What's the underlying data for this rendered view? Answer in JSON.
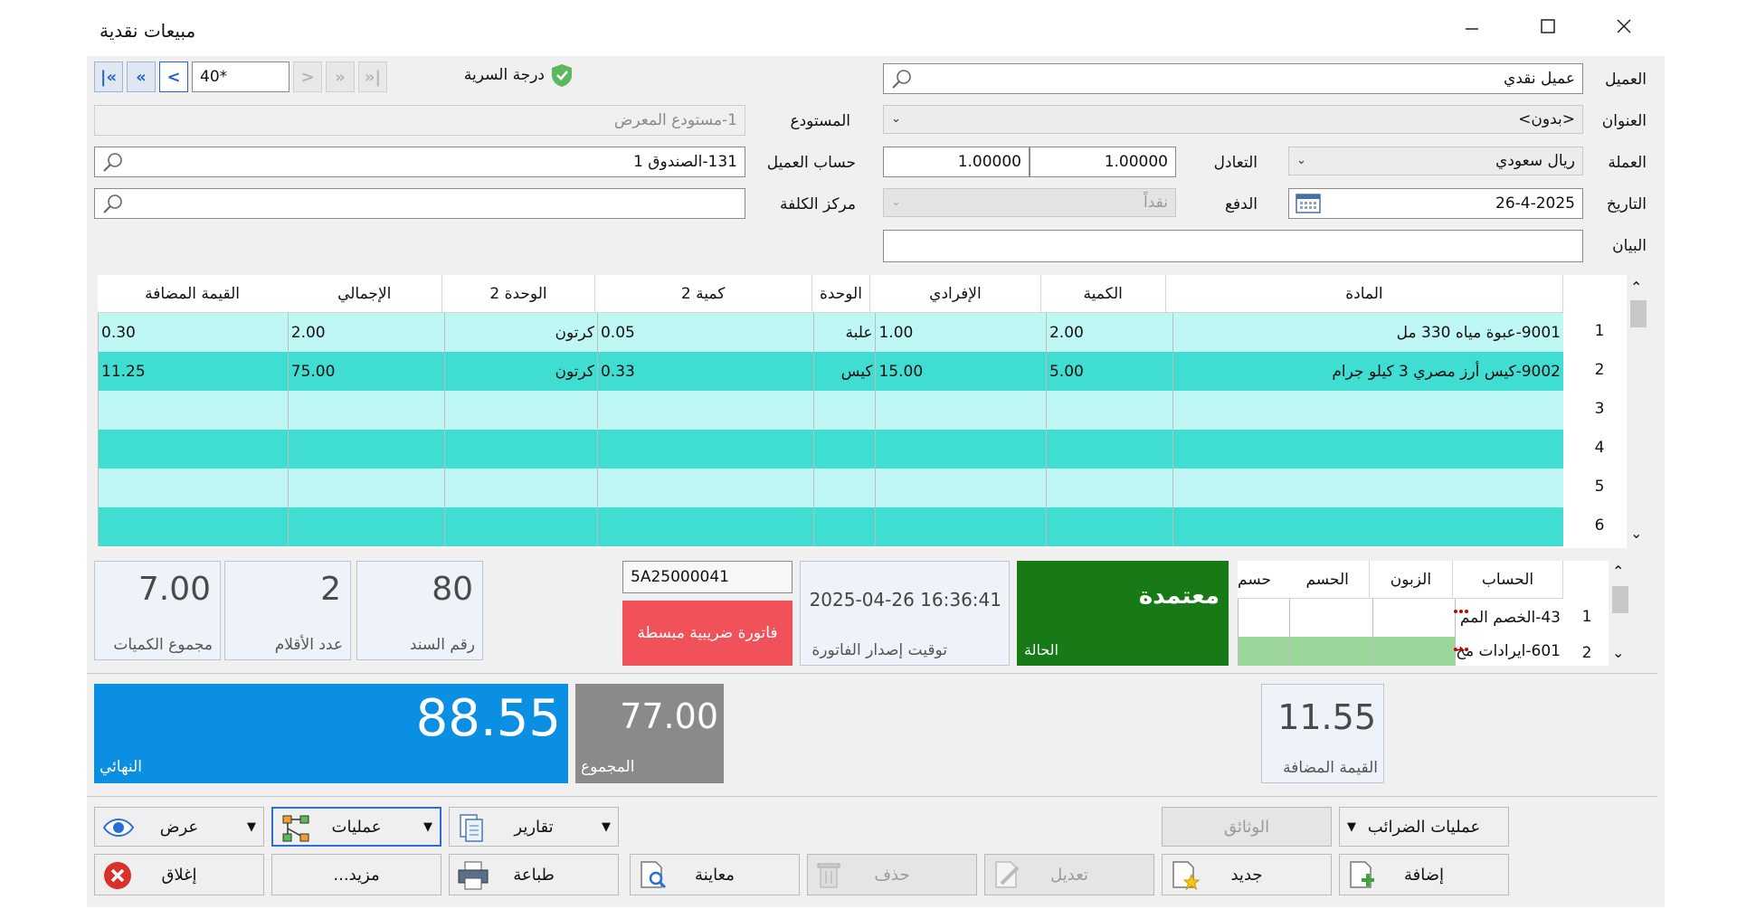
{
  "window": {
    "title": "مبيعات نقدية"
  },
  "header": {
    "customer_label": "العميل",
    "customer_value": "عميل نقدي",
    "address_label": "العنوان",
    "address_value": "<بدون>",
    "currency_label": "العملة",
    "currency_value": "ريال سعودي",
    "parity_label": "التعادل",
    "parity_value_1": "1.00000",
    "parity_value_2": "1.00000",
    "date_label": "التاريخ",
    "date_value": "26-4-2025",
    "payment_label": "الدفع",
    "payment_value": "نقداً",
    "notes_label": "البيان",
    "notes_value": "",
    "confidentiality_label": "درجة السرية",
    "record_value": "40*",
    "warehouse_label": "المستودع",
    "warehouse_value": "1-مستودع المعرض",
    "customer_account_label": "حساب العميل",
    "customer_account_value": "131-الصندوق 1",
    "cost_center_label": "مركز الكلفة",
    "cost_center_value": ""
  },
  "items_grid": {
    "columns": [
      "المادة",
      "الكمية",
      "الإفرادي",
      "الوحدة",
      "كمية 2",
      "الوحدة 2",
      "الإجمالي",
      "القيمة المضافة"
    ],
    "rows": [
      {
        "num": "1",
        "item": "9001-عبوة مياه 330 مل",
        "qty": "2.00",
        "price": "1.00",
        "unit": "علبة",
        "qty2": "0.05",
        "unit2": "كرتون",
        "total": "2.00",
        "vat": "0.30"
      },
      {
        "num": "2",
        "item": "9002-كيس أرز مصري 3 كيلو جرام",
        "qty": "5.00",
        "price": "15.00",
        "unit": "كيس",
        "qty2": "0.33",
        "unit2": "كرتون",
        "total": "75.00",
        "vat": "11.25"
      },
      {
        "num": "3",
        "item": "",
        "qty": "",
        "price": "",
        "unit": "",
        "qty2": "",
        "unit2": "",
        "total": "",
        "vat": ""
      },
      {
        "num": "4",
        "item": "",
        "qty": "",
        "price": "",
        "unit": "",
        "qty2": "",
        "unit2": "",
        "total": "",
        "vat": ""
      },
      {
        "num": "5",
        "item": "",
        "qty": "",
        "price": "",
        "unit": "",
        "qty2": "",
        "unit2": "",
        "total": "",
        "vat": ""
      },
      {
        "num": "6",
        "item": "",
        "qty": "",
        "price": "",
        "unit": "",
        "qty2": "",
        "unit2": "",
        "total": "",
        "vat": ""
      }
    ]
  },
  "accounts_grid": {
    "columns": [
      "الحساب",
      "الزبون",
      "الحسم",
      "حسم"
    ],
    "rows": [
      {
        "num": "1",
        "account": "43-الخصم المم"
      },
      {
        "num": "2",
        "account": "601-ايرادات مخ"
      }
    ]
  },
  "status": {
    "state_value": "معتمدة",
    "state_label": "الحالة",
    "issue_time_value": "2025-04-26 16:36:41",
    "issue_time_label": "توقيت إصدار الفاتورة",
    "invoice_code": "5A25000041",
    "invoice_type": "فاتورة ضريبية مبسطة"
  },
  "stats": {
    "doc_number_value": "80",
    "doc_number_label": "رقم السند",
    "items_count_value": "2",
    "items_count_label": "عدد الأقلام",
    "qty_total_value": "7.00",
    "qty_total_label": "مجموع الكميات"
  },
  "totals": {
    "final_value": "88.55",
    "final_label": "النهائي",
    "sum_value": "77.00",
    "sum_label": "المجموع",
    "vat_value": "11.55",
    "vat_label": "القيمة المضافة"
  },
  "buttons": {
    "tax_ops": "عمليات الضرائب",
    "documents": "الوثائق",
    "reports": "تقارير",
    "operations": "عمليات",
    "view": "عرض",
    "add": "إضافة",
    "new": "جديد",
    "edit": "تعديل",
    "delete": "حذف",
    "preview": "معاينة",
    "print": "طباعة",
    "more": "مزيد...",
    "close": "إغلاق"
  },
  "colors": {
    "row_light": "#bff7f5",
    "row_dark": "#40ddd2",
    "status_green": "#177a17",
    "invoice_red": "#f1525a",
    "final_blue": "#0b8fe3",
    "sum_gray": "#8a8a8a"
  }
}
